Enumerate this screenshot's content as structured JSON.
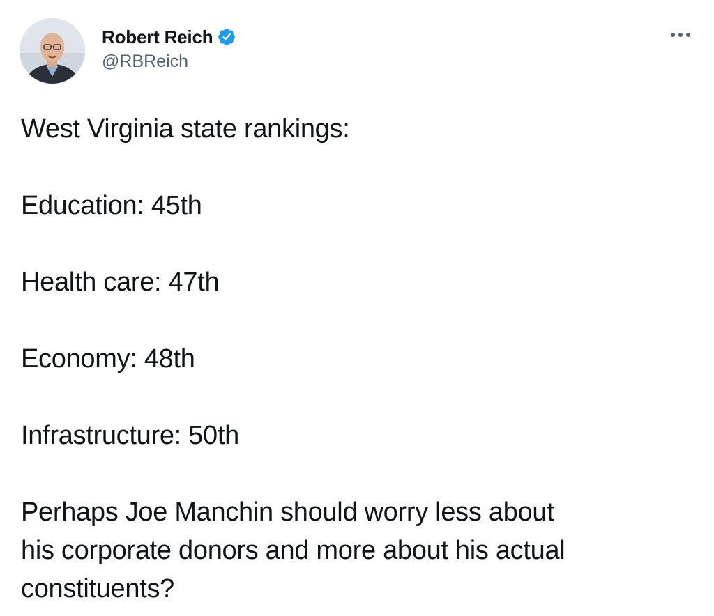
{
  "author": {
    "display_name": "Robert Reich",
    "handle": "@RBReich",
    "verified": true,
    "avatar_icon": "profile-photo",
    "verified_color": "#1d9bf0"
  },
  "menu": {
    "more_icon": "more-horizontal-icon"
  },
  "tweet": {
    "lines": [
      "West Virginia state rankings:",
      "",
      "Education: 45th",
      "",
      "Health care: 47th",
      "",
      "Economy: 48th",
      "",
      "Infrastructure: 50th",
      "",
      "Perhaps Joe Manchin should worry less about",
      "his corporate donors and more about his actual",
      "constituents?"
    ]
  },
  "colors": {
    "text_primary": "#0f1419",
    "text_secondary": "#536471",
    "background": "#ffffff"
  }
}
